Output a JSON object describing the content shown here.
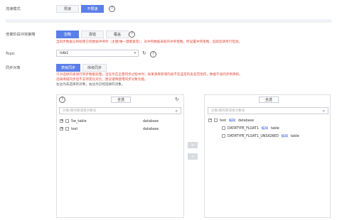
{
  "flow_mode": {
    "label": "流速模式",
    "options": [
      "限速",
      "不限速"
    ],
    "active_index": 1
  },
  "incremental": {
    "label": "增量阶段冲突策略",
    "options": [
      "忽略",
      "报错",
      "覆盖"
    ],
    "active_index": 0,
    "hint": "当同步数据与目标库已有数据冲突时（主键/唯一键重复等），对冲突数据采取的冲突策略，所设置冲突策略，追踪后请另行检测。"
  },
  "topic": {
    "label": "Topic",
    "value": "tidb1"
  },
  "sync_object": {
    "label": "同步对象",
    "options": [
      "表级同步",
      "库级同步"
    ],
    "active_index": 0,
    "warn1": "只对选择的表进行同步数据处理，当任务在全量同步过程中时，如果源库新增的表不在选定的表名范围内，数据不会同步到目标。",
    "warn2": "选择库级同步后不支持变化对比，建议谨慎使用同步对象功能。",
    "note1": "左边为未选择的对象，右边为已经选择的对象。"
  },
  "left_panel": {
    "select_all": "全选",
    "search_placeholder": "对象/库的库或者对象名",
    "rows": [
      {
        "name": "5w_table",
        "type": "database"
      },
      {
        "name": "test",
        "type": "database"
      }
    ]
  },
  "right_panel": {
    "select_all": "全选",
    "search_placeholder": "对象/库的库或者对象名",
    "root": {
      "name": "test",
      "edit": "编辑",
      "type": "database"
    },
    "children": [
      {
        "name": "DATATYPE_FLOAT1",
        "edit": "编辑",
        "type": "table"
      },
      {
        "name": "DATATYPE_FLOAT1_UNSIGNED",
        "edit": "编辑",
        "type": "table"
      }
    ]
  },
  "transfer": {
    "to_right": "»",
    "to_left": "«"
  },
  "icons": {
    "help": "?",
    "refresh": "↻",
    "search": "⌕",
    "dropdown": "▾"
  }
}
